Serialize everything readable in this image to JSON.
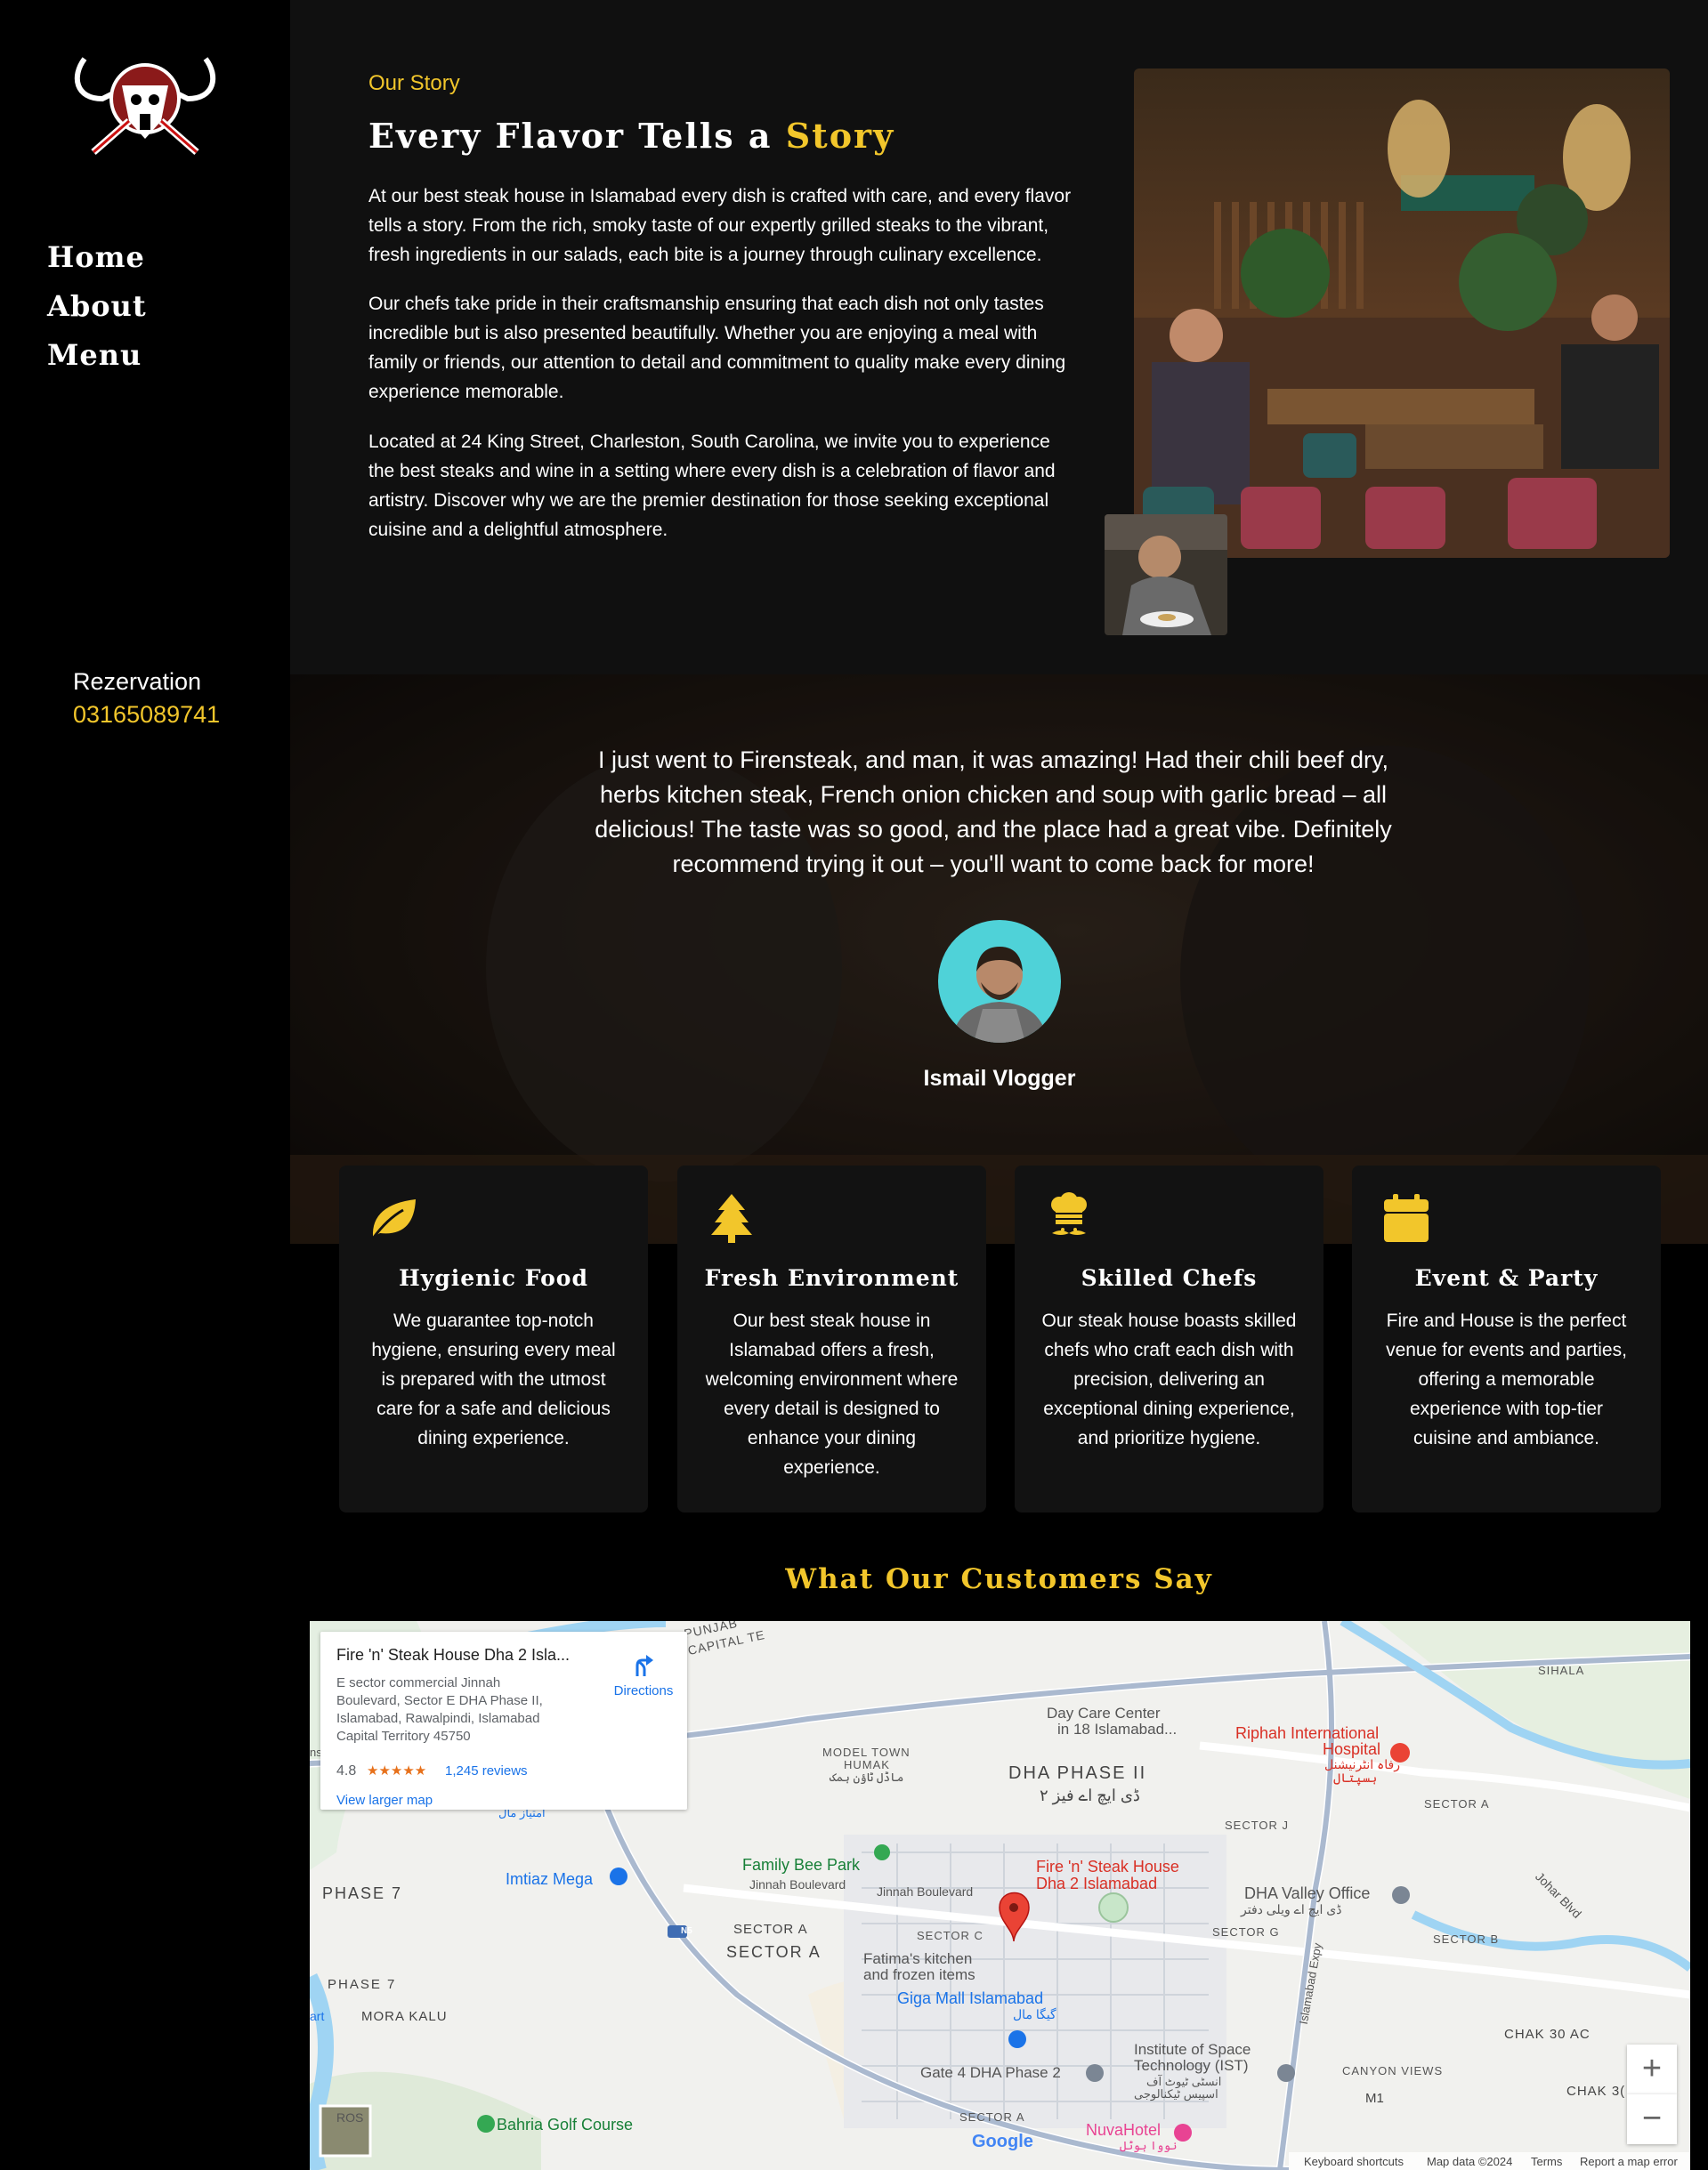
{
  "sidebar": {
    "nav": [
      "Home",
      "About",
      "Menu"
    ],
    "reservation_label": "Rezervation",
    "reservation_phone": "03165089741"
  },
  "story": {
    "kicker": "Our Story",
    "title_main": "Every Flavor Tells a ",
    "title_highlight": "Story",
    "paragraphs": [
      "At our best steak house in Islamabad every dish is crafted with care, and every flavor tells a story. From the rich, smoky taste of our expertly grilled steaks to the vibrant, fresh ingredients in our salads, each bite is a journey through culinary excellence.",
      "Our chefs take pride in their craftsmanship ensuring that each dish not only tastes incredible but is also presented beautifully. Whether you are enjoying a meal with family or friends, our attention to detail and commitment to quality make every dining experience memorable.",
      "Located at 24 King Street, Charleston, South Carolina, we invite you to experience the best steaks and wine in a setting where every dish is a celebration of flavor and artistry. Discover why we are the premier destination for those seeking exceptional cuisine and a delightful atmosphere."
    ]
  },
  "testimonial": {
    "quote": "I just went to Firensteak, and man, it was amazing! Had their chili beef dry, herbs kitchen steak, French onion chicken and soup with garlic bread – all delicious! The taste was so good, and the place had a great vibe. Definitely recommend trying it out – you'll want to come back for more!",
    "author": "Ismail Vlogger"
  },
  "features": [
    {
      "icon": "leaf-icon",
      "title": "Hygienic Food",
      "text": "We guarantee top-notch hygiene, ensuring every meal is prepared with the utmost care for a safe and delicious dining experience."
    },
    {
      "icon": "tree-icon",
      "title": "Fresh Environment",
      "text": "Our best steak house in Islamabad offers a fresh, welcoming environment where every detail is designed to enhance your dining experience."
    },
    {
      "icon": "chef-hat-icon",
      "title": "Skilled Chefs",
      "text": "Our steak house boasts skilled chefs who craft each dish with precision, delivering an exceptional dining experience, and prioritize hygiene."
    },
    {
      "icon": "calendar-icon",
      "title": "Event & Party",
      "text": "Fire and House is the perfect venue for events and parties, offering a memorable experience with top-tier cuisine and ambiance."
    }
  ],
  "customers_title": "What Our Customers Say",
  "map": {
    "place_name": "Fire 'n' Steak House Dha 2 Isla...",
    "address": "E sector commercial Jinnah Boulevard, Sector E DHA Phase II, Islamabad, Rawalpindi, Islamabad Capital Territory 45750",
    "rating": "4.8",
    "stars": "★★★★★",
    "reviews": "1,245 reviews",
    "directions": "Directions",
    "larger_map": "View larger map",
    "pin_label_1": "Fire 'n' Steak House",
    "pin_label_2": "Dha 2 Islamabad",
    "labels": {
      "dha_phase_ii": "DHA PHASE II",
      "dha_urdu": "ڈی ایچ اے فیز ۲",
      "model_town": "MODEL TOWN",
      "humak": "HUMAK",
      "model_town_urdu": "ماڈل ٹاؤن ہمک",
      "day_care": "Day Care Center",
      "day_care_2": "in 18 Islamabad...",
      "riphah_1": "Riphah International",
      "riphah_2": "Hospital",
      "riphah_urdu": "رفاہ انٹرنیشنل",
      "riphah_urdu_2": "ہسپتال",
      "sihala": "SIHALA",
      "sector_a_right": "SECTOR A",
      "sector_j": "SECTOR J",
      "family_bee_park": "Family Bee Park",
      "jinnah_blvd_1": "Jinnah Boulevard",
      "jinnah_blvd_2": "Jinnah Boulevard",
      "imtiaz_mega": "Imtiaz Mega",
      "phase_7": "PHASE 7",
      "phase_7b": "PHASE 7",
      "sector_a": "SECTOR A",
      "sector_a_big": "SECTOR A",
      "sector_c": "SECTOR C",
      "fatimas_1": "Fatima's kitchen",
      "fatimas_2": "and frozen items",
      "giga_mall": "Giga Mall Islamabad",
      "giga_urdu": "گیگا مال",
      "dha_valley": "DHA Valley Office",
      "dha_valley_urdu": "ڈی ایچ اے ویلی دفتر",
      "sector_g": "SECTOR G",
      "sector_b": "SECTOR B",
      "johar_blvd": "Johar Blvd",
      "islamabad_expy": "Islamabad Expy",
      "chak_30_ac": "CHAK 30 AC",
      "chak_30": "CHAK 3(",
      "canyon_views": "CANYON VIEWS",
      "m1": "M1",
      "ist_1": "Institute of Space",
      "ist_2": "Technology (IST)",
      "ist_urdu": "انسٹی ٹیوٹ آف",
      "ist_urdu_2": "اسپیس ٹیکنالوجی",
      "gate_4": "Gate 4 DHA Phase 2",
      "morakalu": "MORA KALU",
      "bahria_golf": "Bahria Golf Course",
      "sector_a_bottom": "SECTOR A",
      "nuva_hotel": "NuvaHotel",
      "nuva_urdu": "نووا ہوٹل",
      "punjab": "PUNJAB",
      "capital": "CAPITAL TE",
      "mall_urdu": "امتیاز مال",
      "n5": "N5",
      "art": "art",
      "ns": "ns",
      "ros": "ROS",
      "google": "Google"
    },
    "footer": {
      "shortcuts": "Keyboard shortcuts",
      "mapdata": "Map data ©2024",
      "terms": "Terms",
      "report": "Report a map error"
    },
    "zoom_in": "+",
    "zoom_out": "−"
  },
  "colors": {
    "accent": "#f2c62b",
    "background": "#000000",
    "panel": "#121212"
  }
}
